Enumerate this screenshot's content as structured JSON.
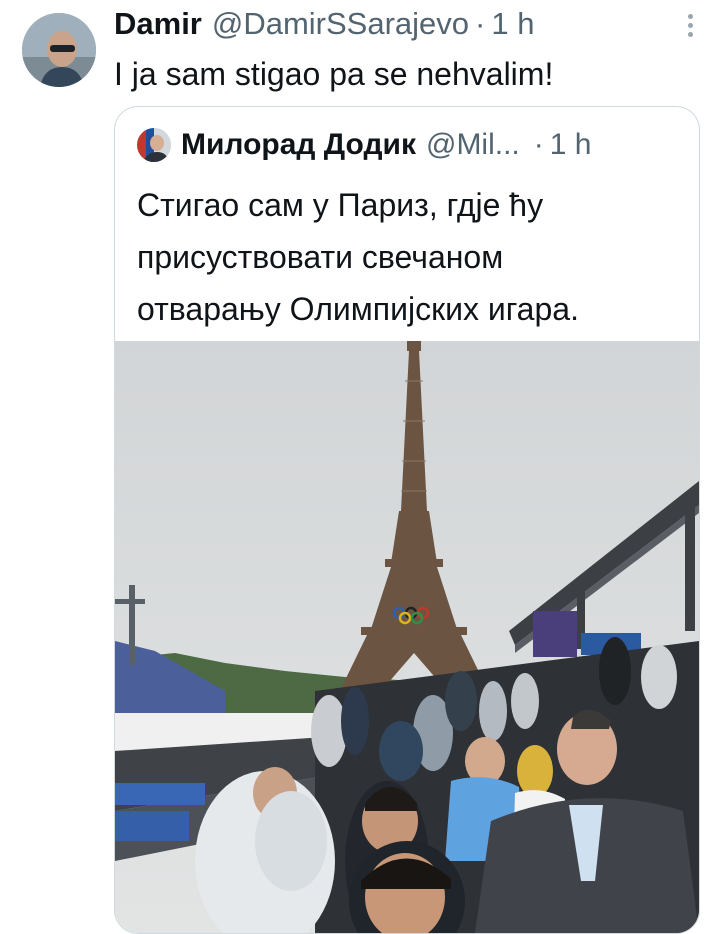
{
  "tweet": {
    "author_name": "Damir",
    "author_handle": "@DamirSSarajevo",
    "separator": "·",
    "time": "1 h",
    "text": "I ja sam stigao pa se nehvalim!"
  },
  "quoted": {
    "author_name": "Милорад Додик",
    "author_handle": "@Mil...",
    "separator": "·",
    "time": "1 h",
    "text_lines": [
      "Стигао сам у Париз, гдје ћу",
      "присуствовати свечаном",
      "отварању Олимпијских игара."
    ]
  },
  "icons": {
    "more": "more-vertical-icon"
  },
  "colors": {
    "text": "#0f1419",
    "secondary": "#536471",
    "border": "#cfd9de",
    "sky": "#d9dcde",
    "tower": "#6b5442"
  }
}
